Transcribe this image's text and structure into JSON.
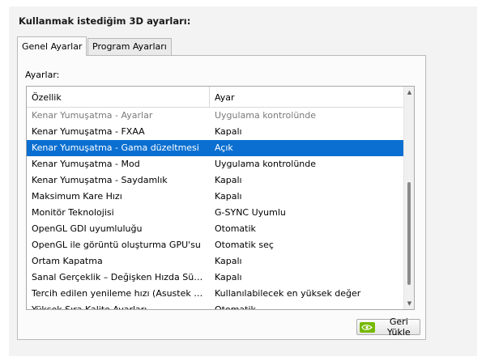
{
  "heading": "Kullanmak istediğim 3D ayarları:",
  "tabs": [
    {
      "label": "Genel Ayarlar",
      "active": true
    },
    {
      "label": "Program Ayarları",
      "active": false
    }
  ],
  "settings_label": "Ayarlar:",
  "table": {
    "headers": [
      "Özellik",
      "Ayar"
    ],
    "rows": [
      {
        "feature": "Kenar Yumuşatma - Ayarlar",
        "value": "Uygulama kontrolünde",
        "state": "disabled"
      },
      {
        "feature": "Kenar Yumuşatma - FXAA",
        "value": "Kapalı",
        "state": "normal"
      },
      {
        "feature": "Kenar Yumuşatma - Gama düzeltmesi",
        "value": "Açık",
        "state": "selected"
      },
      {
        "feature": "Kenar Yumuşatma - Mod",
        "value": "Uygulama kontrolünde",
        "state": "normal"
      },
      {
        "feature": "Kenar Yumuşatma - Saydamlık",
        "value": "Kapalı",
        "state": "normal"
      },
      {
        "feature": "Maksimum Kare Hızı",
        "value": "Kapalı",
        "state": "normal"
      },
      {
        "feature": "Monitör Teknolojisi",
        "value": "G-SYNC Uyumlu",
        "state": "normal"
      },
      {
        "feature": "OpenGL GDI uyumluluğu",
        "value": "Otomatik",
        "state": "normal"
      },
      {
        "feature": "OpenGL ile görüntü oluşturma GPU'su",
        "value": "Otomatik seç",
        "state": "normal"
      },
      {
        "feature": "Ortam Kapatma",
        "value": "Kapalı",
        "state": "normal"
      },
      {
        "feature": "Sanal Gerçeklik – Değişken Hızda Süper Ör...",
        "value": "Kapalı",
        "state": "normal"
      },
      {
        "feature": "Tercih edilen yenileme hızı (Asustek Comp...",
        "value": "Kullanılabilecek en yüksek değer",
        "state": "normal"
      },
      {
        "feature": "Yüksek Sıra Kalite Ayarları",
        "value": "Otomatik",
        "state": "normal"
      }
    ]
  },
  "restore_button": {
    "label": "Geri Yükle",
    "icon": "nvidia-logo-icon"
  },
  "colors": {
    "selection": "#0a6fd1",
    "nvidia_green": "#76b900"
  }
}
